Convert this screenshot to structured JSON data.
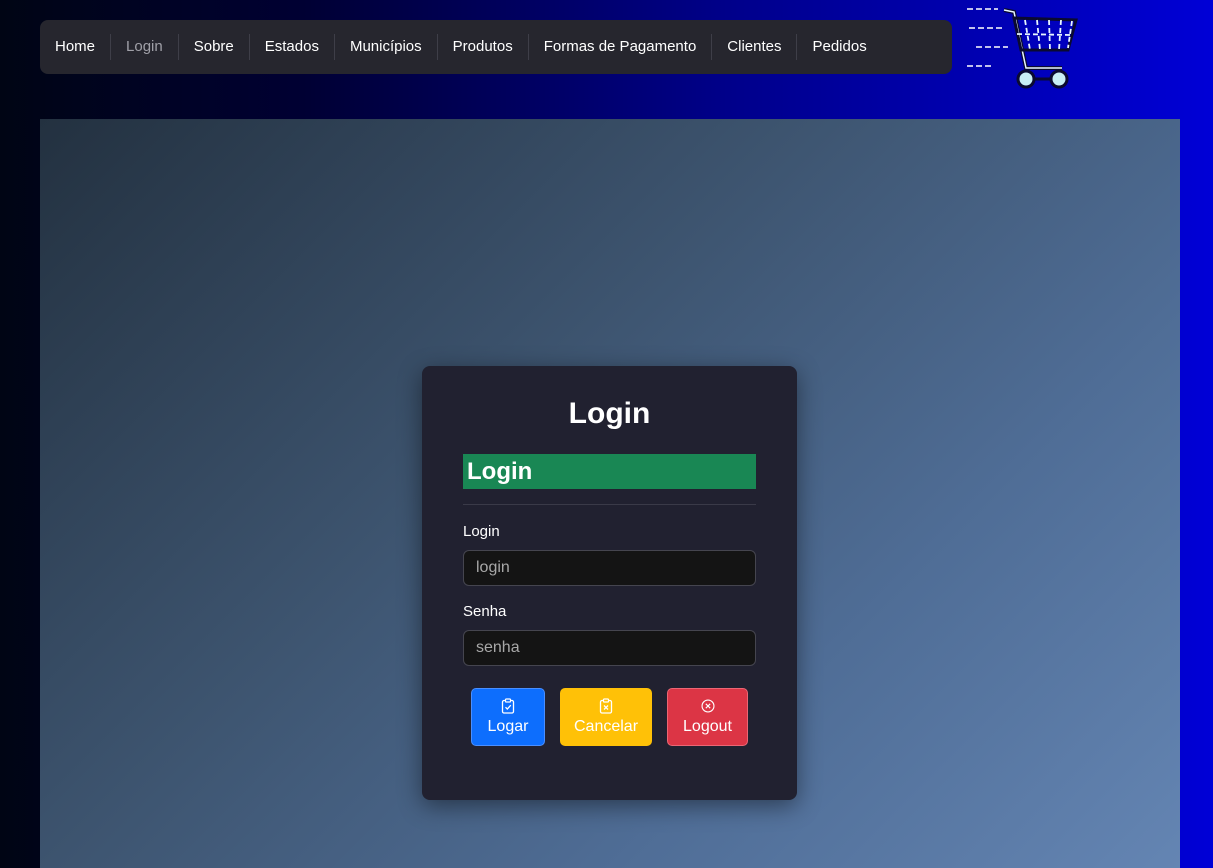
{
  "nav": {
    "items": [
      {
        "label": "Home"
      },
      {
        "label": "Login",
        "active": true
      },
      {
        "label": "Sobre"
      },
      {
        "label": "Estados"
      },
      {
        "label": "Municípios"
      },
      {
        "label": "Produtos"
      },
      {
        "label": "Formas de Pagamento"
      },
      {
        "label": "Clientes"
      },
      {
        "label": "Pedidos"
      }
    ]
  },
  "logo": {
    "icon": "shopping-cart-icon"
  },
  "login_card": {
    "title": "Login",
    "banner": "Login",
    "login_label": "Login",
    "login_placeholder": "login",
    "password_label": "Senha",
    "password_placeholder": "senha",
    "buttons": {
      "login": "Logar",
      "cancel": "Cancelar",
      "logout": "Logout"
    }
  },
  "colors": {
    "nav_bg": "#26262e",
    "card_bg": "#212130",
    "banner_bg": "#198754",
    "primary": "#0d6efd",
    "warning": "#ffc107",
    "danger": "#dc3545"
  }
}
